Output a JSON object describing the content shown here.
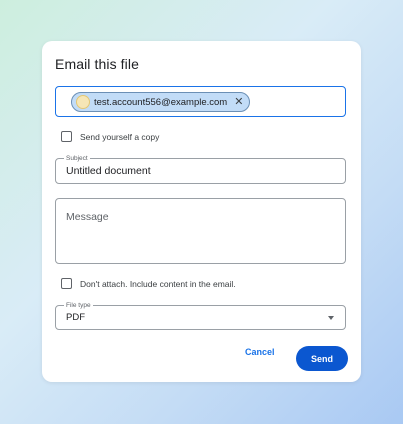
{
  "dialog": {
    "title": "Email this file",
    "recipients": [
      {
        "email": "test.account556@example.com"
      }
    ],
    "send_copy": {
      "label": "Send yourself a copy",
      "checked": false
    },
    "subject": {
      "label": "Subject",
      "value": "Untitled document"
    },
    "message": {
      "placeholder": "Message"
    },
    "dont_attach": {
      "label": "Don't attach. Include content in the email.",
      "checked": false
    },
    "file_type": {
      "label": "File type",
      "value": "PDF"
    },
    "cancel_label": "Cancel",
    "send_label": "Send",
    "colors": {
      "accent": "#1a73e8",
      "send_button": "#0b57d0",
      "chip_bg": "#c2dcf7"
    }
  }
}
